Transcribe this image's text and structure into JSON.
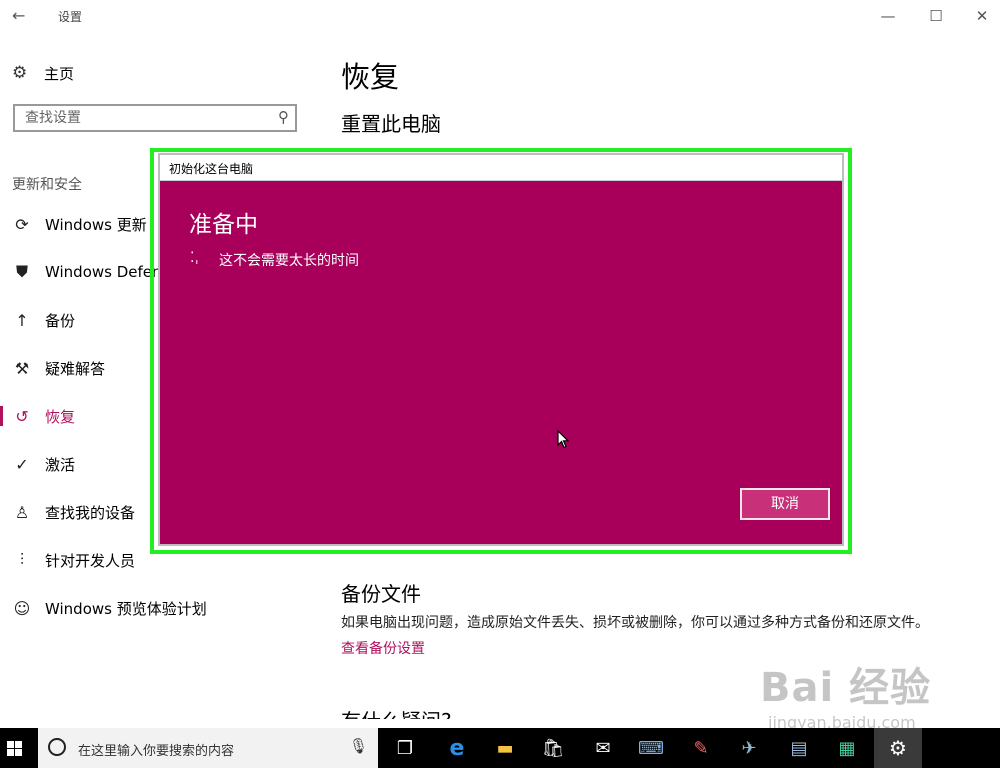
{
  "window": {
    "title": "设置",
    "back_glyph": "←",
    "minimize_glyph": "—",
    "maximize_glyph": "☐",
    "close_glyph": "✕"
  },
  "sidebar": {
    "home_label": "主页",
    "search_placeholder": "查找设置",
    "section_label": "更新和安全",
    "items": [
      {
        "label": "Windows 更新",
        "icon": "sync-icon"
      },
      {
        "label": "Windows Defender",
        "icon": "shield-icon"
      },
      {
        "label": "备份",
        "icon": "upload-arrow-icon"
      },
      {
        "label": "疑难解答",
        "icon": "wrench-icon"
      },
      {
        "label": "恢复",
        "icon": "history-icon",
        "active": true
      },
      {
        "label": "激活",
        "icon": "check-circle-icon"
      },
      {
        "label": "查找我的设备",
        "icon": "person-location-icon"
      },
      {
        "label": "针对开发人员",
        "icon": "sliders-icon"
      },
      {
        "label": "Windows 预览体验计划",
        "icon": "cat-icon"
      }
    ]
  },
  "main": {
    "page_title": "恢复",
    "reset_heading": "重置此电脑",
    "backup_heading": "备份文件",
    "backup_desc": "如果电脑出现问题，造成原始文件丢失、损坏或被删除，你可以通过多种方式备份和还原文件。",
    "backup_link": "查看备份设置",
    "faq_heading": "有什么疑问?"
  },
  "dialog": {
    "title": "初始化这台电脑",
    "heading": "准备中",
    "message": "这不会需要太长的时间",
    "cancel_label": "取消"
  },
  "taskbar": {
    "search_placeholder": "在这里输入你要搜索的内容"
  },
  "watermark": {
    "main": "Bai 经验",
    "sub": "jingyan.baidu.com"
  },
  "colors": {
    "accent": "#b0105f",
    "dialog_bg": "#a8005a",
    "highlight_frame": "#22ee22"
  }
}
